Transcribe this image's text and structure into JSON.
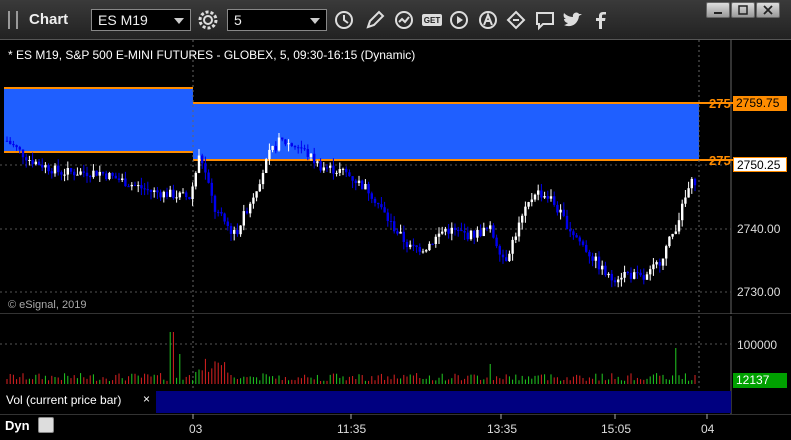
{
  "toolbar": {
    "title": "Chart",
    "symbol": "ES M19",
    "interval": "5",
    "icons": [
      "settings-icon",
      "clock-icon",
      "pencil-icon",
      "study-icon",
      "get-icon",
      "play-icon",
      "alert-icon",
      "link-icon",
      "chat-icon",
      "twitter-icon",
      "facebook-icon"
    ],
    "window_controls": [
      "minimize-icon",
      "maximize-icon",
      "close-icon"
    ]
  },
  "price_pane": {
    "title": "* ES M19, S&P 500 E-MINI FUTURES - GLOBEX, 5, 09:30-16:15 (Dynamic)",
    "copyright": "© eSignal, 2019",
    "axis_labels": [
      "2740.00",
      "2730.00"
    ],
    "upper_level_label": "275",
    "upper_level_price": "2759.75",
    "lower_level_label": "275",
    "last_price": "2750.25",
    "colors": {
      "band": "#1f5fff",
      "level_line": "#ff8c00",
      "down_candle": "#0000ee",
      "up_candle": "#ffffff"
    }
  },
  "volume_pane": {
    "axis_label": "100000",
    "last_volume": "12137",
    "legend": "Vol (current price bar)",
    "close_symbol": "×"
  },
  "time_axis": {
    "labels": [
      "03",
      "11:35",
      "13:35",
      "15:05",
      "04"
    ],
    "dynamic_label": "Dyn"
  }
}
